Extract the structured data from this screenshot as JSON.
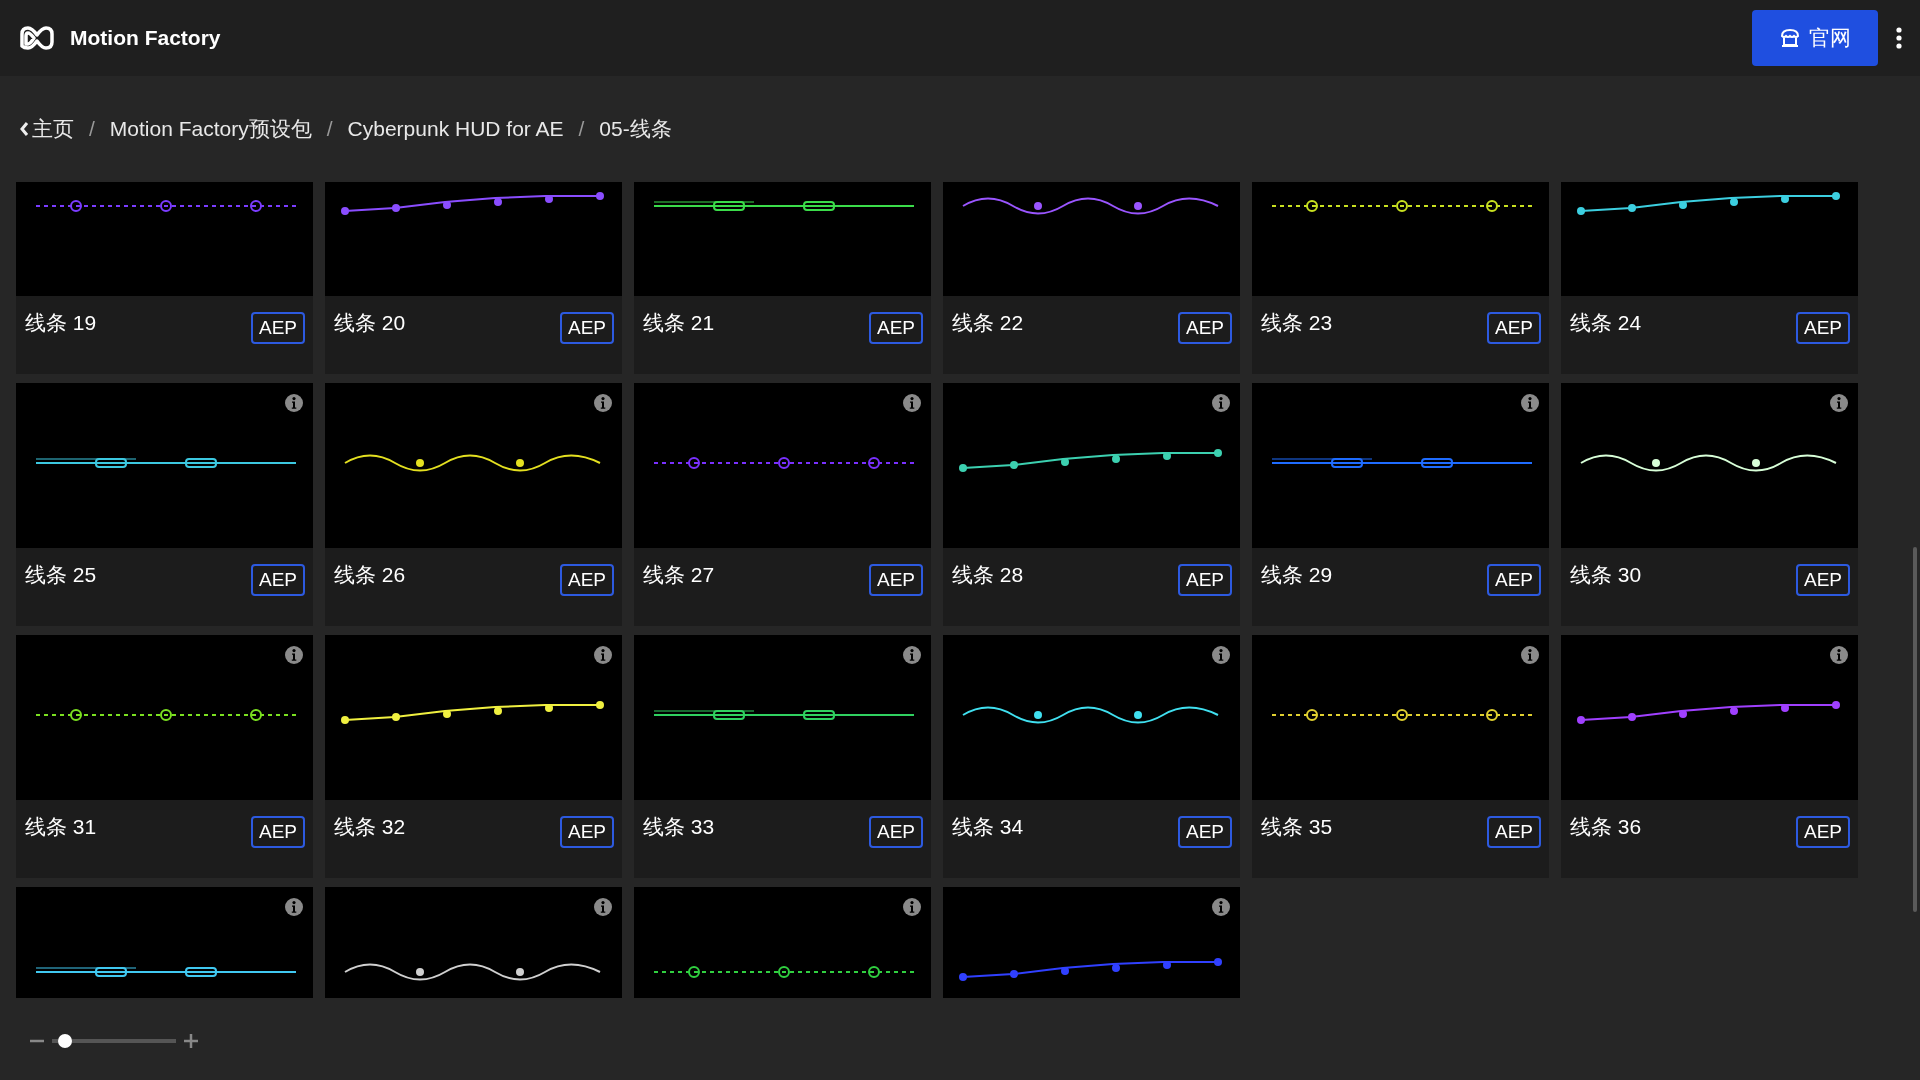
{
  "app": {
    "title": "Motion Factory"
  },
  "header_button": {
    "label": "官网"
  },
  "breadcrumb_separator": "/",
  "breadcrumb": [
    {
      "label": "主页",
      "kind": "back"
    },
    {
      "label": "Motion Factory预设包",
      "kind": "link"
    },
    {
      "label": "Cyberpunk HUD for AE",
      "kind": "link"
    },
    {
      "label": "05-线条",
      "kind": "current"
    }
  ],
  "cards": [
    {
      "title": "线条 19",
      "format": "AEP"
    },
    {
      "title": "线条 20",
      "format": "AEP"
    },
    {
      "title": "线条 21",
      "format": "AEP"
    },
    {
      "title": "线条 22",
      "format": "AEP"
    },
    {
      "title": "线条 23",
      "format": "AEP"
    },
    {
      "title": "线条 24",
      "format": "AEP"
    },
    {
      "title": "线条 25",
      "format": "AEP",
      "info_icon": true
    },
    {
      "title": "线条 26",
      "format": "AEP",
      "info_icon": true
    },
    {
      "title": "线条 27",
      "format": "AEP",
      "info_icon": true
    },
    {
      "title": "线条 28",
      "format": "AEP",
      "info_icon": true
    },
    {
      "title": "线条 29",
      "format": "AEP",
      "info_icon": true
    },
    {
      "title": "线条 30",
      "format": "AEP",
      "info_icon": true
    },
    {
      "title": "线条 31",
      "format": "AEP",
      "info_icon": true
    },
    {
      "title": "线条 32",
      "format": "AEP",
      "info_icon": true
    },
    {
      "title": "线条 33",
      "format": "AEP",
      "info_icon": true
    },
    {
      "title": "线条 34",
      "format": "AEP",
      "info_icon": true
    },
    {
      "title": "线条 35",
      "format": "AEP",
      "info_icon": true
    },
    {
      "title": "线条 36",
      "format": "AEP",
      "info_icon": true
    },
    {
      "info_icon": true
    },
    {
      "info_icon": true
    },
    {
      "info_icon": true
    },
    {
      "info_icon": true
    }
  ],
  "zoom_slider": {
    "level": 0.05
  }
}
